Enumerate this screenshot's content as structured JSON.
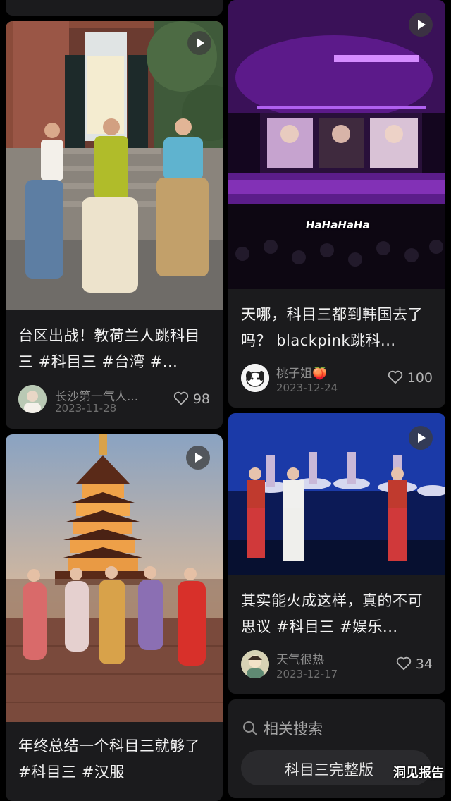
{
  "cards": {
    "left1": {
      "title": "台区出战！教荷兰人跳科目三 #科目三 #台湾 #...",
      "author": "长沙第一气人...",
      "date": "2023-11-28",
      "likes": "98"
    },
    "right1": {
      "overlay_text": "HaHaHaHa",
      "title": "天哪，科目三都到韩国去了吗？ blackpink跳科...",
      "author": "桃子姐🍑",
      "date": "2023-12-24",
      "likes": "100"
    },
    "left2": {
      "title": "年终总结一个科目三就够了 #科目三 #汉服"
    },
    "right2": {
      "title": "其实能火成这样，真的不可思议 #科目三 #娱乐...",
      "author": "天气很热",
      "date": "2023-12-17",
      "likes": "34"
    }
  },
  "related": {
    "label": "相关搜索",
    "chip": "科目三完整版"
  },
  "watermark": "洞见报告",
  "icons": {
    "play": "play-icon",
    "heart": "heart-outline-icon",
    "search": "search-icon"
  }
}
